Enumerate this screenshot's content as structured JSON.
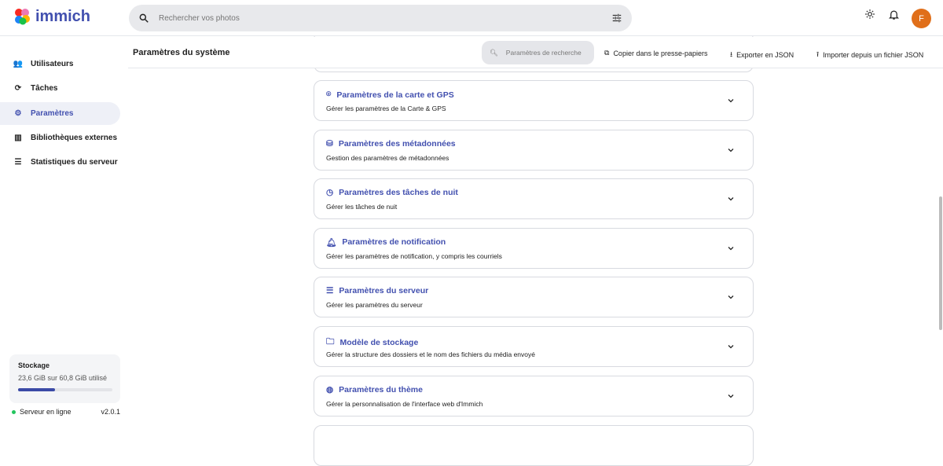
{
  "app": {
    "name": "immich",
    "accent": "#4250af"
  },
  "search": {
    "placeholder": "Rechercher vos photos"
  },
  "user": {
    "initial": "F",
    "avatar_color": "#e06f1a"
  },
  "sidebar": {
    "items": [
      {
        "label": "Utilisateurs",
        "icon": "users-icon",
        "active": false
      },
      {
        "label": "Tâches",
        "icon": "sync-icon",
        "active": false
      },
      {
        "label": "Paramètres",
        "icon": "gear-icon",
        "active": true
      },
      {
        "label": "Bibliothèques externes",
        "icon": "library-icon",
        "active": false
      },
      {
        "label": "Statistiques du serveur",
        "icon": "server-icon",
        "active": false
      }
    ],
    "storage": {
      "title": "Stockage",
      "usage": "23,6 GiB sur 60,8 GiB utilisé",
      "percent": 38.8
    },
    "server": {
      "status": "Serveur en ligne",
      "version": "v2.0.1"
    }
  },
  "header": {
    "title": "Paramètres du système",
    "search_placeholder": "Paramètres de recherche",
    "copy": "Copier dans le presse-papiers",
    "export": "Exporter en JSON",
    "import": "Importer depuis un fichier JSON"
  },
  "cards": [
    {
      "title": "Paramètres de la carte et GPS",
      "desc": "Gérer les paramètres de la Carte & GPS",
      "icon": "map-pin-icon"
    },
    {
      "title": "Paramètres des métadonnées",
      "desc": "Gestion des paramètres de métadonnées",
      "icon": "database-icon"
    },
    {
      "title": "Paramètres des tâches de nuit",
      "desc": "Gérer les tâches de nuit",
      "icon": "clock-icon"
    },
    {
      "title": "Paramètres de notification",
      "desc": "Gérer les paramètres de notification, y compris les courriels",
      "icon": "bell-icon"
    },
    {
      "title": "Paramètres du serveur",
      "desc": "Gérer les paramètres du serveur",
      "icon": "server-icon"
    },
    {
      "title": "Modèle de stockage",
      "desc": "Gérer la structure des dossiers et le nom des fichiers du média envoyé",
      "icon": "folder-icon"
    },
    {
      "title": "Paramètres du thème",
      "desc": "Gérer la personnalisation de l'interface web d'Immich",
      "icon": "palette-icon"
    }
  ]
}
